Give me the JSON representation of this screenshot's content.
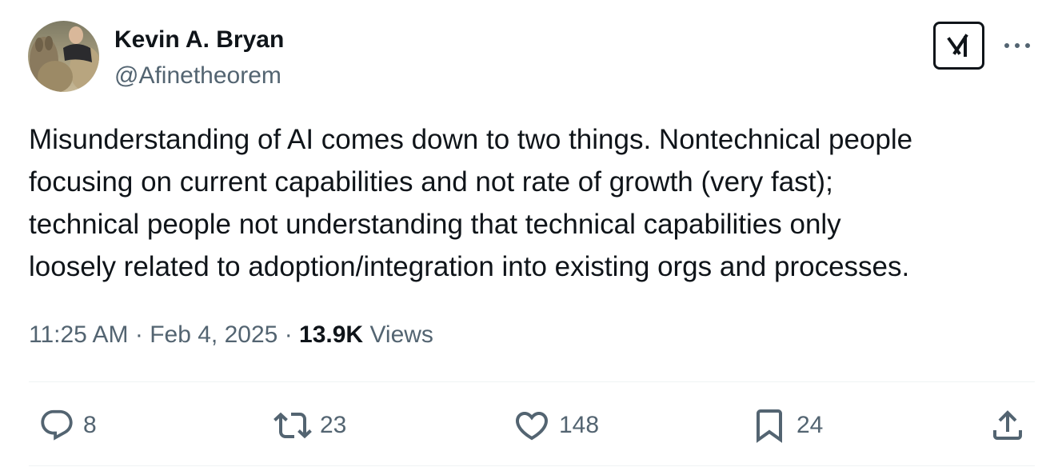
{
  "author": {
    "name": "Kevin A. Bryan",
    "handle": "@Afinetheorem"
  },
  "tweet": {
    "text_lines": [
      "Misunderstanding of AI comes down to two things. Nontechnical people",
      "focusing on current capabilities and not rate of growth (very fast);",
      "technical people not understanding that technical capabilities only",
      "loosely related to adoption/integration into existing orgs and processes."
    ],
    "time": "11:25 AM",
    "separator": "·",
    "date": "Feb 4, 2025",
    "views_count": "13.9K",
    "views_label": "Views"
  },
  "actions": {
    "replies": "8",
    "reposts": "23",
    "likes": "148",
    "bookmarks": "24"
  },
  "icons": {
    "grok": "grok-icon",
    "more": "more-horizontal-icon",
    "reply": "reply-icon",
    "repost": "repost-icon",
    "like": "heart-icon",
    "bookmark": "bookmark-icon",
    "share": "share-icon"
  },
  "colors": {
    "text_primary": "#0f1419",
    "text_secondary": "#536471",
    "divider": "#eff3f4"
  }
}
